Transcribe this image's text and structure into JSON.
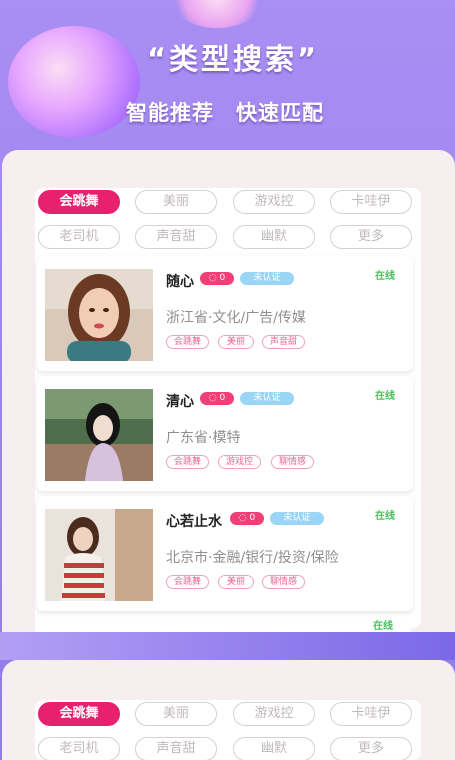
{
  "hero": {
    "title": "“类型搜索”",
    "subtitle": "智能推荐　快速匹配"
  },
  "tags": [
    "会跳舞",
    "美丽",
    "游戏控",
    "卡哇伊",
    "老司机",
    "声音甜",
    "幽默",
    "更多"
  ],
  "profiles": [
    {
      "name": "随心",
      "message_count": "0",
      "verification": "未认证",
      "status": "在线",
      "location": "浙江省·文化/广告/传媒",
      "chips": [
        "会跳舞",
        "美丽",
        "声音甜"
      ]
    },
    {
      "name": "清心",
      "message_count": "0",
      "verification": "未认证",
      "status": "在线",
      "location": "广东省·模特",
      "chips": [
        "会跳舞",
        "游戏控",
        "聊情感"
      ]
    },
    {
      "name": "心若止水",
      "message_count": "0",
      "verification": "未认证",
      "status": "在线",
      "location": "北京市·金融/银行/投资/保险",
      "chips": [
        "会跳舞",
        "美丽",
        "聊情感"
      ]
    }
  ],
  "fourth_profile": {
    "status": "在线"
  },
  "colors": {
    "accent": "#e8216f",
    "background": "#a98ef3",
    "online": "#45c55d",
    "verify": "#9bd5f6"
  }
}
